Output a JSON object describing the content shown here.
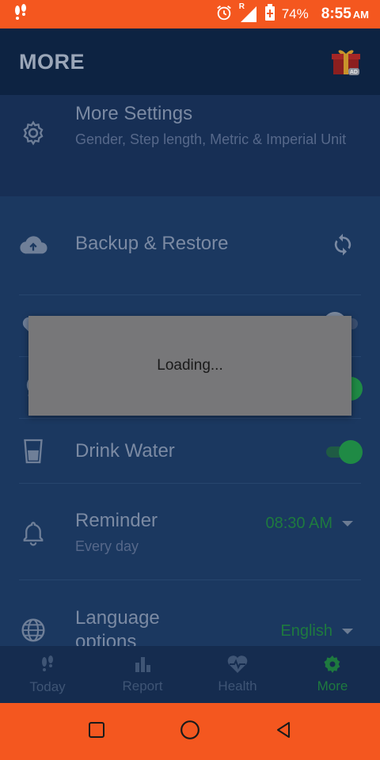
{
  "status_bar": {
    "battery": "74%",
    "time": "8:55",
    "ampm": "AM",
    "signal_label": "R"
  },
  "app_bar": {
    "title": "MORE",
    "gift_badge": "AD"
  },
  "rows": {
    "more_settings": {
      "label": "More Settings",
      "sub": "Gender, Step length, Metric & Imperial Unit"
    },
    "backup": {
      "label": "Backup & Restore"
    },
    "drink_water": {
      "label": "Drink Water",
      "enabled": true
    },
    "reminder": {
      "label": "Reminder",
      "sub": "Every day",
      "time": "08:30 AM"
    },
    "language": {
      "label": "Language options",
      "value": "English"
    }
  },
  "dialog": {
    "message": "Loading..."
  },
  "bottom_nav": {
    "items": [
      {
        "label": "Today"
      },
      {
        "label": "Report"
      },
      {
        "label": "Health"
      },
      {
        "label": "More"
      }
    ]
  },
  "colors": {
    "status_bar": "#f4571f",
    "app_bar": "#0d2342",
    "content_bg": "#1b3860",
    "accent_green": "#1e7a3f"
  }
}
